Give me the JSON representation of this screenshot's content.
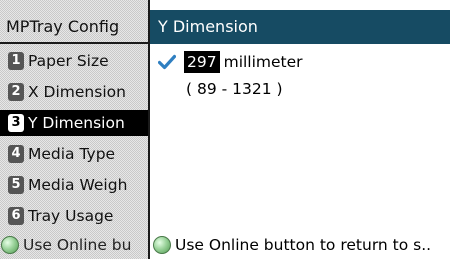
{
  "menu": {
    "title": "MPTray Config",
    "items": [
      {
        "number": "1",
        "label": "Paper Size"
      },
      {
        "number": "2",
        "label": "X Dimension"
      },
      {
        "number": "3",
        "label": "Y Dimension"
      },
      {
        "number": "4",
        "label": "Media Type"
      },
      {
        "number": "5",
        "label": "Media Weigh"
      },
      {
        "number": "6",
        "label": "Tray Usage"
      }
    ],
    "active_item": "Y Dimension",
    "hint": "Use Online bu"
  },
  "content": {
    "title": "Y Dimension",
    "value": "297",
    "unit": "millimeter",
    "range": "( 89 - 1321 )",
    "hint": "Use Online button to return to s.."
  },
  "colors": {
    "header_bg": "#164b63",
    "check": "#2f7fc1",
    "online_icon": "#9bd39b"
  },
  "icons": {
    "selected": "checkmark-icon",
    "online": "online-button-icon"
  }
}
